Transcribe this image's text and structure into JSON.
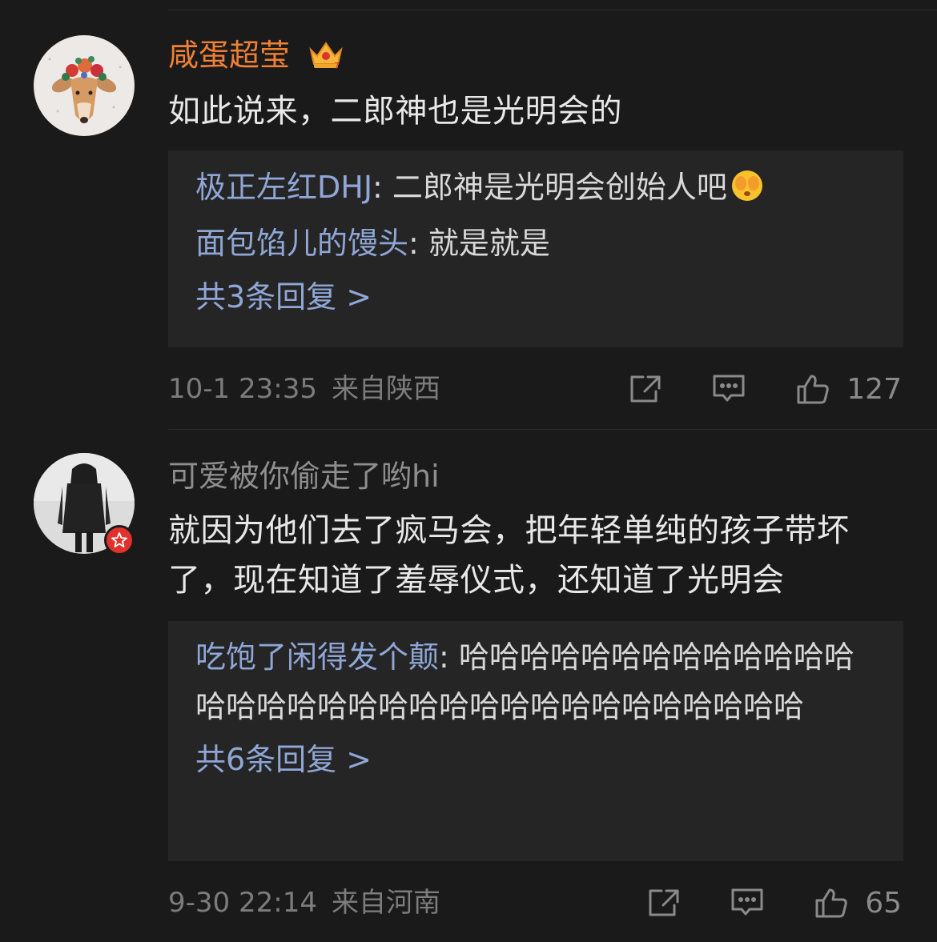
{
  "comments": [
    {
      "username": "咸蛋超莹",
      "text": "如此说来，二郎神也是光明会的",
      "replies": [
        {
          "name": "极正左红DHJ",
          "text": ": 二郎神是光明会创始人吧"
        },
        {
          "name": "面包馅儿的馒头",
          "text": ": 就是就是"
        }
      ],
      "more_replies": "共3条回复 >",
      "time": "10-1 23:35",
      "location": "来自陕西",
      "likes": "127"
    },
    {
      "username": "可爱被你偷走了哟hi",
      "text": "就因为他们去了疯马会，把年轻单纯的孩子带坏了，现在知道了羞辱仪式，还知道了光明会",
      "replies": [
        {
          "name": "吃饱了闲得发个颠",
          "text": ": 哈哈哈哈哈哈哈哈哈哈哈哈哈哈哈哈哈哈哈哈哈哈哈哈哈哈哈哈哈哈哈哈哈"
        }
      ],
      "more_replies": "共6条回复 >",
      "time": "9-30 22:14",
      "location": "来自河南",
      "likes": "65"
    }
  ],
  "colors": {
    "background": "#1a1a1a",
    "vip_name": "#f08033",
    "reply_name": "#8fa6d6",
    "reply_box": "#252525"
  },
  "icons": [
    "crown-icon",
    "share-icon",
    "comment-icon",
    "like-icon",
    "verified-badge-icon"
  ]
}
